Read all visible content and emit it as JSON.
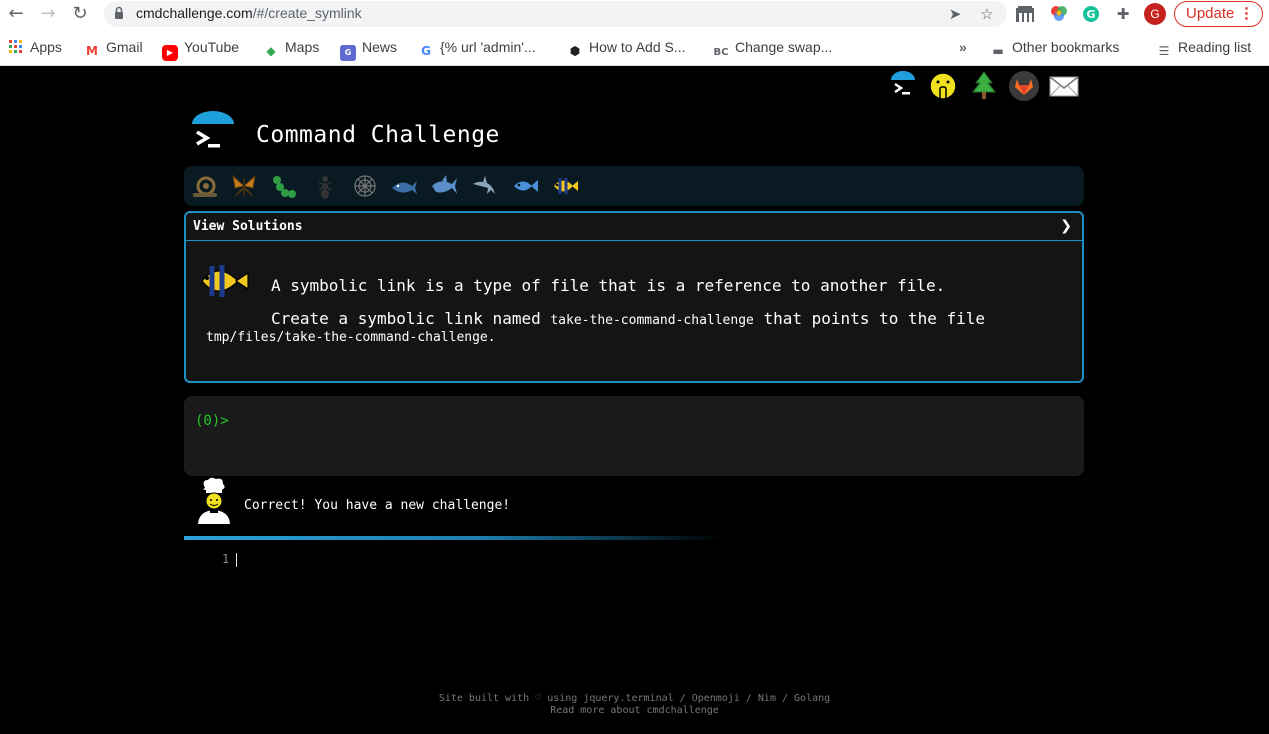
{
  "browser": {
    "url_host": "cmdchallenge.com",
    "url_path": "/#/create_symlink",
    "update_label": "Update",
    "profile_initial": "G",
    "bookmarks": [
      {
        "label": "Apps",
        "icon": "apps-grid-icon"
      },
      {
        "label": "Gmail",
        "icon": "gmail-icon"
      },
      {
        "label": "YouTube",
        "icon": "youtube-icon"
      },
      {
        "label": "Maps",
        "icon": "maps-icon"
      },
      {
        "label": "News",
        "icon": "news-icon"
      },
      {
        "label": "{% url 'admin'...",
        "icon": "google-icon"
      },
      {
        "label": "How to Add S...",
        "icon": "hexagon-icon"
      },
      {
        "label": "Change swap...",
        "icon": "bc-icon"
      }
    ],
    "bookmarks_overflow": "»",
    "other_bookmarks": "Other bookmarks",
    "reading_list": "Reading list"
  },
  "page": {
    "title": "Command Challenge",
    "solutions": {
      "label": "View Solutions",
      "chevron": "❯"
    },
    "challenge": {
      "line1": "A symbolic link is a type of file that is a reference to another file.",
      "line2_before": "Create a symbolic link named ",
      "line2_code": "take-the-command-challenge",
      "line2_after": " that points to the file",
      "line3_code": "tmp/files/take-the-command-challenge",
      "line3_after": "."
    },
    "terminal": {
      "prompt": "(0)>"
    },
    "status_message": "Correct! You have a new challenge!",
    "editor_line_number": "1",
    "footer": {
      "line1": "Site built with ♡ using jquery.terminal / Openmoji / Nim / Golang",
      "line2": "Read more about cmdchallenge"
    },
    "colors": {
      "accent": "#1d8fc2",
      "prompt": "#26c826",
      "background": "#000000"
    }
  }
}
